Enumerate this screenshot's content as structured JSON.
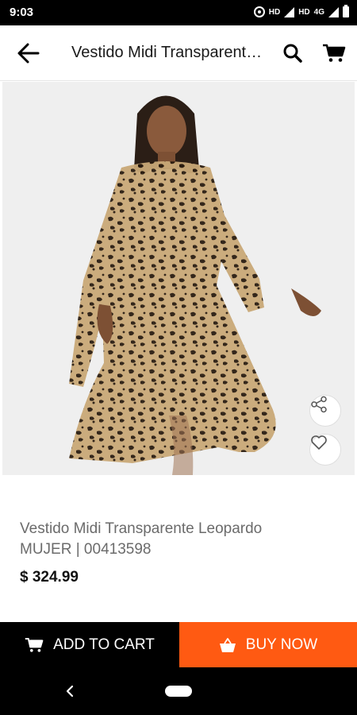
{
  "status_bar": {
    "time": "9:03",
    "network_hd1": "HD",
    "network_hd2": "HD",
    "network_type": "4G"
  },
  "header": {
    "title": "Vestido Midi Transparente Leopardo"
  },
  "product": {
    "name": "Vestido Midi Transparente Leopardo",
    "meta": "MUJER | 00413598",
    "price": "$ 324.99"
  },
  "actions": {
    "add_to_cart": "ADD TO CART",
    "buy_now": "BUY NOW"
  },
  "colors": {
    "buy_now_accent": "#ff5a12",
    "add_to_cart_bg": "#000000",
    "image_background": "#efefef"
  },
  "icons": [
    "back-arrow-icon",
    "search-icon",
    "cart-icon",
    "share-icon",
    "heart-icon",
    "bag-icon"
  ]
}
